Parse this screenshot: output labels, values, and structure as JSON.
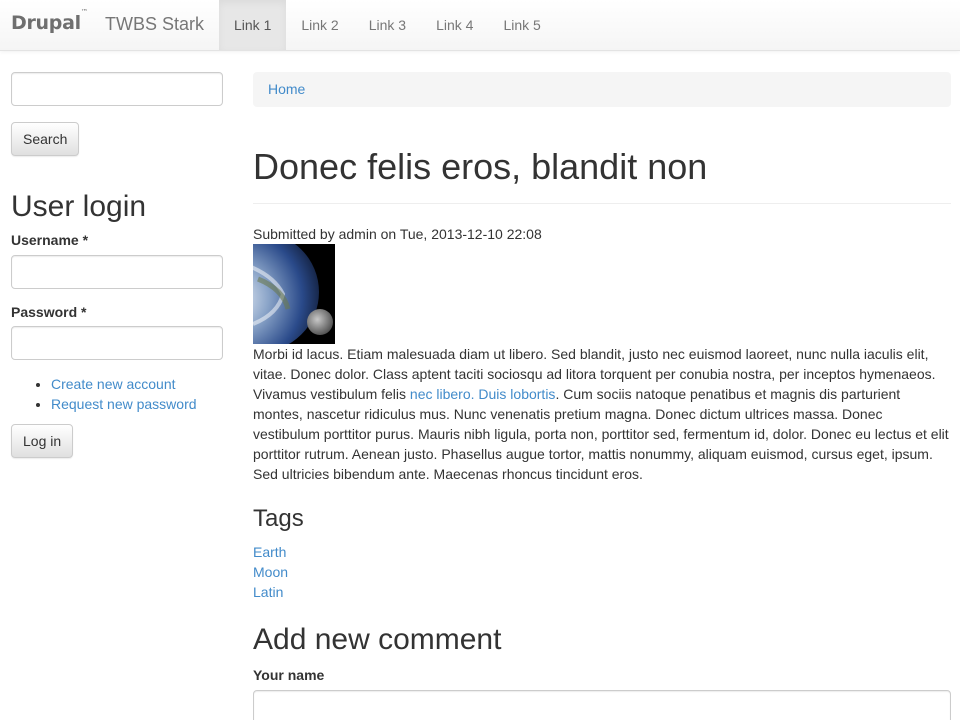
{
  "navbar": {
    "logo_text": "Drupal",
    "logo_tm": "™",
    "site_name": "TWBS Stark",
    "links": [
      "Link 1",
      "Link 2",
      "Link 3",
      "Link 4",
      "Link 5"
    ],
    "active_index": 0
  },
  "sidebar": {
    "search": {
      "value": "",
      "placeholder": "",
      "button_label": "Search"
    },
    "login": {
      "title": "User login",
      "username_label": "Username *",
      "password_label": "Password *",
      "links": [
        "Create new account",
        "Request new password"
      ],
      "login_button": "Log in"
    }
  },
  "main": {
    "breadcrumb": "Home",
    "title": "Donec felis eros, blandit non",
    "submitted": "Submitted by admin on Tue, 2013-12-10 22:08",
    "body_before_link": "Morbi id lacus. Etiam malesuada diam ut libero. Sed blandit, justo nec euismod laoreet, nunc nulla iaculis elit, vitae. Donec dolor. Class aptent taciti sociosqu ad litora torquent per conubia nostra, per inceptos hymenaeos. Vivamus vestibulum felis ",
    "body_link": "nec libero. Duis lobortis",
    "body_after_link": ". Cum sociis natoque penatibus et magnis dis parturient montes, nascetur ridiculus mus. Nunc venenatis pretium magna. Donec dictum ultrices massa. Donec vestibulum porttitor purus. Mauris nibh ligula, porta non, porttitor sed, fermentum id, dolor. Donec eu lectus et elit porttitor rutrum. Aenean justo. Phasellus augue tortor, mattis nonummy, aliquam euismod, cursus eget, ipsum. Sed ultricies bibendum ante. Maecenas rhoncus tincidunt eros.",
    "tags_title": "Tags",
    "tags": [
      "Earth",
      "Moon",
      "Latin"
    ],
    "comment_title": "Add new comment",
    "your_name_label": "Your name"
  },
  "colors": {
    "link": "#428bca",
    "text": "#333333",
    "breadcrumb_bg": "#f5f5f5"
  }
}
